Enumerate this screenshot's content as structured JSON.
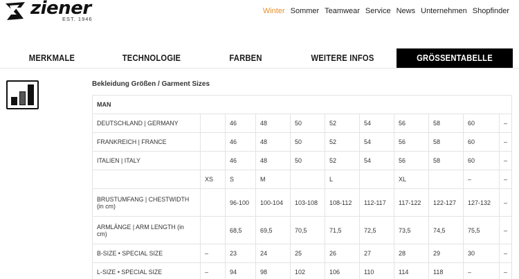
{
  "brand": {
    "name": "ziener",
    "est": "EST. 1946"
  },
  "nav": [
    "Winter",
    "Sommer",
    "Teamwear",
    "Service",
    "News",
    "Unternehmen",
    "Shopfinder"
  ],
  "tabs": [
    "MERKMALE",
    "TECHNOLOGIE",
    "FARBEN",
    "WEITERE INFOS",
    "GRÖSSENTABELLE"
  ],
  "section_title": "Bekleidung Größen / Garment Sizes",
  "table": {
    "group": "MAN",
    "rows": [
      {
        "label": "DEUTSCHLAND | GERMANY",
        "cells": [
          "",
          "46",
          "48",
          "50",
          "52",
          "54",
          "56",
          "58",
          "60",
          "–"
        ]
      },
      {
        "label": "FRANKREICH | FRANCE",
        "cells": [
          "",
          "46",
          "48",
          "50",
          "52",
          "54",
          "56",
          "58",
          "60",
          "–"
        ]
      },
      {
        "label": "ITALIEN | ITALY",
        "cells": [
          "",
          "46",
          "48",
          "50",
          "52",
          "54",
          "56",
          "58",
          "60",
          "–"
        ]
      },
      {
        "label": "",
        "cells": [
          "XS",
          "S",
          "M",
          "",
          "L",
          "",
          "XL",
          "",
          "–",
          "–"
        ]
      },
      {
        "label": "BRUSTUMFANG | CHESTWIDTH (in cm)",
        "cells": [
          "",
          "96-100",
          "100-104",
          "103-108",
          "108-112",
          "112-117",
          "117-122",
          "122-127",
          "127-132",
          "–"
        ]
      },
      {
        "label": "ARMLÄNGE | ARM LENGTH (in cm)",
        "cells": [
          "",
          "68,5",
          "69,5",
          "70,5",
          "71,5",
          "72,5",
          "73,5",
          "74,5",
          "75,5",
          "–"
        ]
      },
      {
        "label": "B-SIZE • SPECIAL SIZE",
        "cells": [
          "–",
          "23",
          "24",
          "25",
          "26",
          "27",
          "28",
          "29",
          "30",
          "–"
        ]
      },
      {
        "label": "L-SIZE • SPECIAL SIZE",
        "cells": [
          "–",
          "94",
          "98",
          "102",
          "106",
          "110",
          "114",
          "118",
          "–",
          "–"
        ]
      }
    ]
  }
}
